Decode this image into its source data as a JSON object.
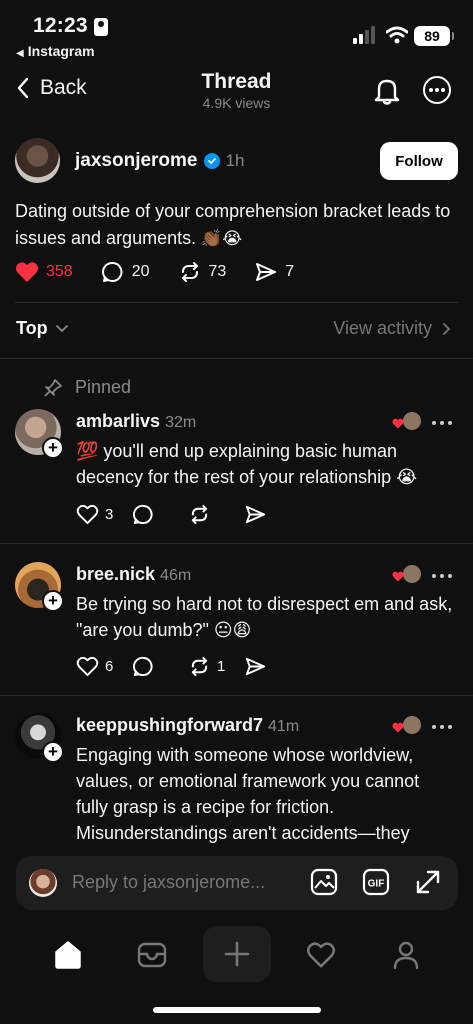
{
  "status": {
    "time": "12:23",
    "back_app": "Instagram",
    "battery": "89"
  },
  "nav": {
    "back_label": "Back",
    "title": "Thread",
    "subtitle": "4.9K views"
  },
  "post": {
    "author": "jaxsonjerome",
    "time": "1h",
    "follow_label": "Follow",
    "text": "Dating outside of your comprehension bracket leads to issues and arguments.",
    "emojis": "👏🏾😭",
    "likes": "358",
    "comments": "20",
    "reposts": "73",
    "shares": "7",
    "accent": "#ff3040"
  },
  "sort": {
    "label": "Top",
    "view_activity": "View activity"
  },
  "pinned_label": "Pinned",
  "replies": [
    {
      "user": "ambarlivs",
      "time": "32m",
      "text": "💯 you'll end up explaining basic human decency for the rest of your relationship 😭",
      "likes": "3",
      "reposts": ""
    },
    {
      "user": "bree.nick",
      "time": "46m",
      "text": "Be trying so hard not to disrespect em and ask, \"are you dumb?\" 😐😩",
      "likes": "6",
      "reposts": "1"
    },
    {
      "user": "keeppushingforward7",
      "time": "41m",
      "text": "Engaging with someone whose worldview, values, or emotional framework you cannot fully grasp is a recipe for friction. Misunderstandings aren't accidents—they",
      "likes": "",
      "reposts": ""
    }
  ],
  "composer": {
    "placeholder": "Reply to jaxsonjerome..."
  }
}
